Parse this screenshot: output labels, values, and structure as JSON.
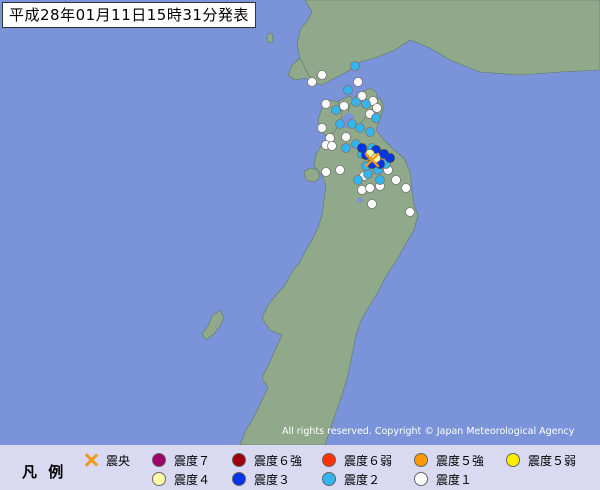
{
  "title": "平成28年01月11日15時31分発表",
  "copyright": "All rights reserved. Copyright © Japan Meteorological Agency",
  "legend": {
    "title": "凡 例",
    "items": [
      {
        "label": "震央",
        "kind": "epicenter",
        "color": "#f39a1a"
      },
      {
        "label": "震度７",
        "kind": "intensity",
        "color": "#a0006a"
      },
      {
        "label": "震度６強",
        "kind": "intensity",
        "color": "#a00010"
      },
      {
        "label": "震度６弱",
        "kind": "intensity",
        "color": "#ff3300"
      },
      {
        "label": "震度５強",
        "kind": "intensity",
        "color": "#ff9900"
      },
      {
        "label": "震度５弱",
        "kind": "intensity",
        "color": "#ffee00"
      },
      {
        "label": "震度４",
        "kind": "intensity",
        "color": "#ffffaa"
      },
      {
        "label": "震度３",
        "kind": "intensity",
        "color": "#0033ee"
      },
      {
        "label": "震度２",
        "kind": "intensity",
        "color": "#33b5f0"
      },
      {
        "label": "震度１",
        "kind": "intensity",
        "color": "#ffffff"
      }
    ]
  },
  "colors": {
    "sea": "#7b93d8",
    "land": "#8fa98a",
    "epicenter": "#f39a1a"
  }
}
